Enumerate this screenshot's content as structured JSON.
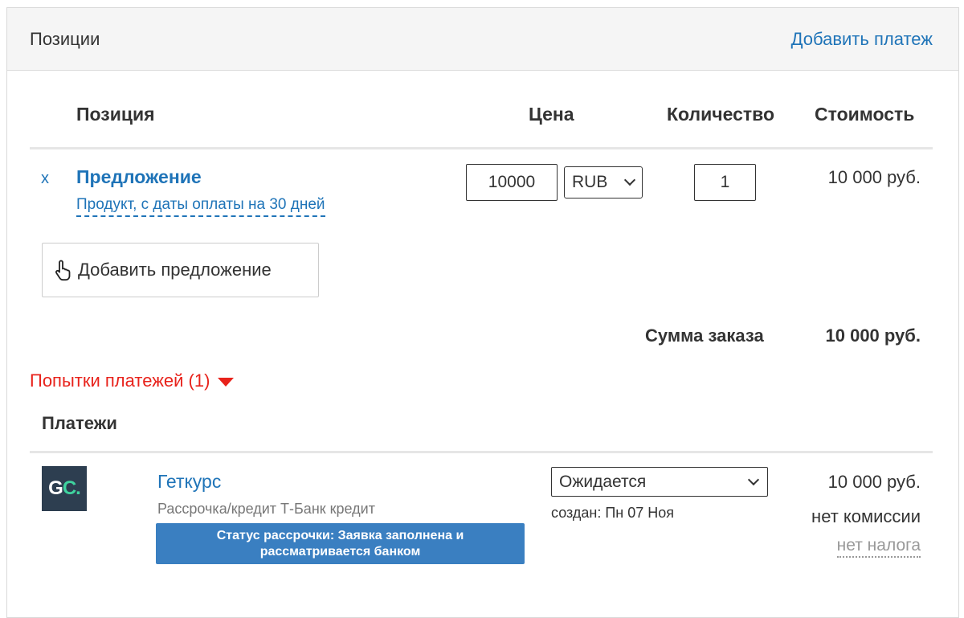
{
  "header": {
    "title": "Позиции",
    "add_payment_link": "Добавить платеж"
  },
  "table": {
    "columns": {
      "position": "Позиция",
      "price": "Цена",
      "quantity": "Количество",
      "cost": "Стоимость"
    },
    "rows": [
      {
        "remove": "x",
        "name": "Предложение",
        "description": "Продукт, с даты оплаты на 30 дней",
        "price": "10000",
        "currency": "RUB",
        "quantity": "1",
        "cost": "10 000 руб."
      }
    ]
  },
  "add_offer_button": "Добавить предложение",
  "order_total": {
    "label": "Сумма заказа",
    "value": "10 000 руб."
  },
  "payment_attempts": "Попытки платежей (1)",
  "payments": {
    "heading": "Платежи",
    "items": [
      {
        "logo_text_g": "G",
        "logo_text_c": "C.",
        "provider": "Геткурс",
        "type": "Рассрочка/кредит Т-Банк кредит",
        "installment_status": "Статус рассрочки: Заявка заполнена и рассматривается банком",
        "status": "Ожидается",
        "created": "создан: Пн 07 Ноя",
        "amount": "10 000 руб.",
        "commission": "нет комиссии",
        "tax": "нет налога"
      }
    ]
  },
  "colors": {
    "link": "#1f74b8",
    "accent_red": "#e8221b",
    "badge_blue": "#3a7fc1",
    "logo_bg": "#2d3e50",
    "logo_accent": "#3fd39f"
  },
  "icons": {
    "add_offer": "hand-pointer-icon",
    "attempts_toggle": "triangle-down-icon",
    "select": "chevron-down-icon"
  }
}
